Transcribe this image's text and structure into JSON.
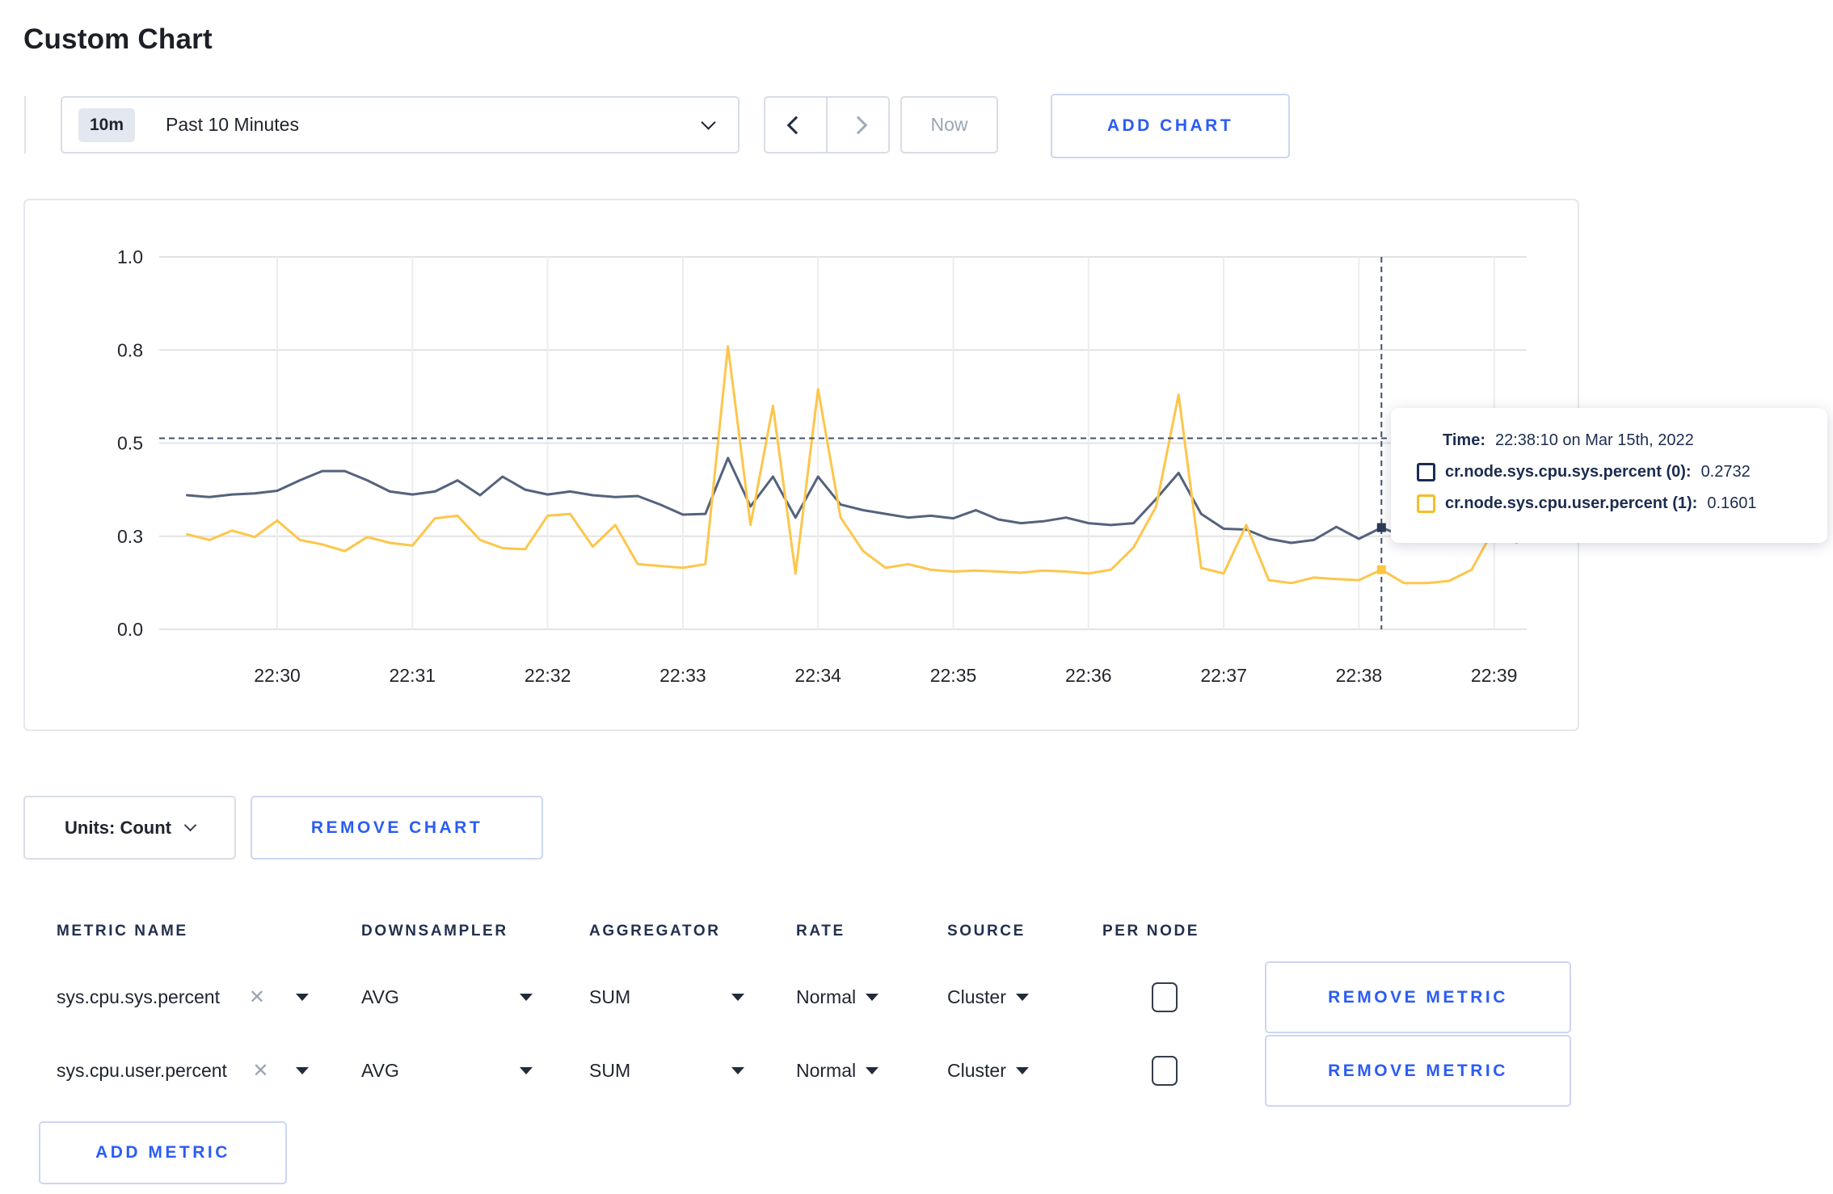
{
  "page": {
    "title": "Custom Chart"
  },
  "toolbar": {
    "timeframe": {
      "badge": "10m",
      "label": "Past 10 Minutes"
    },
    "now_label": "Now",
    "add_chart_label": "ADD CHART"
  },
  "chart_controls": {
    "units_label": "Units: Count",
    "remove_chart_label": "REMOVE CHART"
  },
  "tooltip": {
    "time_label": "Time:",
    "time_value": "22:38:10 on Mar 15th, 2022",
    "series": [
      {
        "label": "cr.node.sys.cpu.sys.percent (0):",
        "value": "0.2732",
        "swatch_color": "#1d2c50"
      },
      {
        "label": "cr.node.sys.cpu.user.percent (1):",
        "value": "0.1601",
        "swatch_color": "#f6bd28"
      }
    ]
  },
  "chart_data": {
    "type": "line",
    "title": "",
    "xlabel": "",
    "ylabel": "",
    "ylim": [
      0,
      1
    ],
    "grid": true,
    "legend_position": "tooltip",
    "x_ticks": [
      "22:30",
      "22:31",
      "22:32",
      "22:33",
      "22:34",
      "22:35",
      "22:36",
      "22:37",
      "22:38",
      "22:39"
    ],
    "y_ticks": [
      {
        "v": 0.0,
        "label": "0.0"
      },
      {
        "v": 0.25,
        "label": "0.3"
      },
      {
        "v": 0.5,
        "label": "0.5"
      },
      {
        "v": 0.75,
        "label": "0.8"
      },
      {
        "v": 1.0,
        "label": "1.0"
      }
    ],
    "x_times": [
      "22:29:20",
      "22:29:30",
      "22:29:40",
      "22:29:50",
      "22:30:00",
      "22:30:10",
      "22:30:20",
      "22:30:30",
      "22:30:40",
      "22:30:50",
      "22:31:00",
      "22:31:10",
      "22:31:20",
      "22:31:30",
      "22:31:40",
      "22:31:50",
      "22:32:00",
      "22:32:10",
      "22:32:20",
      "22:32:30",
      "22:32:40",
      "22:32:50",
      "22:33:00",
      "22:33:10",
      "22:33:20",
      "22:33:30",
      "22:33:40",
      "22:33:50",
      "22:34:00",
      "22:34:10",
      "22:34:20",
      "22:34:30",
      "22:34:40",
      "22:34:50",
      "22:35:00",
      "22:35:10",
      "22:35:20",
      "22:35:30",
      "22:35:40",
      "22:35:50",
      "22:36:00",
      "22:36:10",
      "22:36:20",
      "22:36:30",
      "22:36:40",
      "22:36:50",
      "22:37:00",
      "22:37:10",
      "22:37:20",
      "22:37:30",
      "22:37:40",
      "22:37:50",
      "22:38:00",
      "22:38:10",
      "22:38:20",
      "22:38:30",
      "22:38:40",
      "22:38:50",
      "22:39:00",
      "22:39:10"
    ],
    "series": [
      {
        "name": "cr.node.sys.cpu.sys.percent",
        "color": "#55627d",
        "values": [
          0.36,
          0.355,
          0.362,
          0.365,
          0.372,
          0.4,
          0.425,
          0.425,
          0.4,
          0.37,
          0.362,
          0.37,
          0.4,
          0.36,
          0.41,
          0.375,
          0.362,
          0.37,
          0.36,
          0.355,
          0.358,
          0.335,
          0.308,
          0.31,
          0.46,
          0.33,
          0.41,
          0.3,
          0.41,
          0.335,
          0.32,
          0.31,
          0.3,
          0.305,
          0.298,
          0.32,
          0.295,
          0.285,
          0.29,
          0.3,
          0.285,
          0.28,
          0.285,
          0.35,
          0.42,
          0.31,
          0.27,
          0.268,
          0.243,
          0.232,
          0.24,
          0.275,
          0.243,
          0.2732,
          0.25,
          0.27,
          0.295,
          0.31,
          0.33,
          0.34
        ]
      },
      {
        "name": "cr.node.sys.cpu.user.percent",
        "color": "#fdc64b",
        "values": [
          0.255,
          0.24,
          0.265,
          0.248,
          0.292,
          0.24,
          0.228,
          0.21,
          0.248,
          0.232,
          0.225,
          0.298,
          0.305,
          0.24,
          0.218,
          0.215,
          0.305,
          0.31,
          0.222,
          0.28,
          0.175,
          0.17,
          0.165,
          0.175,
          0.76,
          0.28,
          0.6,
          0.15,
          0.645,
          0.3,
          0.21,
          0.165,
          0.175,
          0.16,
          0.155,
          0.158,
          0.155,
          0.152,
          0.158,
          0.155,
          0.15,
          0.16,
          0.22,
          0.33,
          0.63,
          0.165,
          0.15,
          0.28,
          0.132,
          0.124,
          0.139,
          0.135,
          0.132,
          0.1601,
          0.124,
          0.124,
          0.13,
          0.16,
          0.27,
          0.232
        ]
      }
    ],
    "crosshair": {
      "time": "22:38:10",
      "guideline_value": 0.513,
      "markers": [
        {
          "series": "cr.node.sys.cpu.sys.percent",
          "value": 0.2732,
          "color": "#2a3b58"
        },
        {
          "series": "cr.node.sys.cpu.user.percent",
          "value": 0.1601,
          "color": "#fdc541"
        }
      ]
    }
  },
  "metrics_table": {
    "columns": [
      "METRIC NAME",
      "DOWNSAMPLER",
      "AGGREGATOR",
      "RATE",
      "SOURCE",
      "PER NODE"
    ],
    "rows": [
      {
        "name": "sys.cpu.sys.percent",
        "downsampler": "AVG",
        "aggregator": "SUM",
        "rate": "Normal",
        "source": "Cluster",
        "remove_label": "REMOVE METRIC"
      },
      {
        "name": "sys.cpu.user.percent",
        "downsampler": "AVG",
        "aggregator": "SUM",
        "rate": "Normal",
        "source": "Cluster",
        "remove_label": "REMOVE METRIC"
      }
    ],
    "add_metric_label": "ADD METRIC"
  }
}
